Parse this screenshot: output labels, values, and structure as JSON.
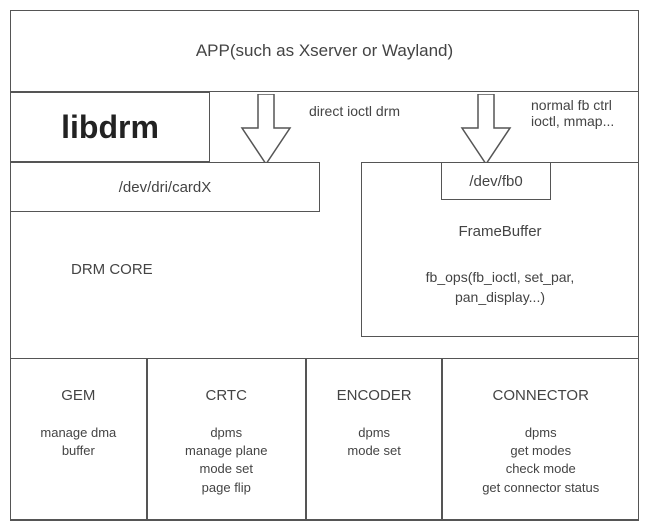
{
  "app": {
    "label": "APP(such as Xserver or Wayland)"
  },
  "libdrm": {
    "label": "libdrm"
  },
  "arrows": {
    "direct": {
      "label": "direct ioctl drm"
    },
    "normal": {
      "label": "normal fb ctrl\nioctl, mmap..."
    }
  },
  "devdri": {
    "label": "/dev/dri/cardX"
  },
  "devfb0": {
    "label": "/dev/fb0"
  },
  "drmcore": {
    "label": "DRM CORE"
  },
  "framebuffer": {
    "title": "FrameBuffer",
    "ops1": "fb_ops(fb_ioctl, set_par,",
    "ops2": "pan_display...)"
  },
  "bottom": {
    "gem": {
      "title": "GEM",
      "d1": "manage dma",
      "d2": "buffer"
    },
    "crtc": {
      "title": "CRTC",
      "d1": "dpms",
      "d2": "manage plane",
      "d3": "mode set",
      "d4": "page flip"
    },
    "encoder": {
      "title": "ENCODER",
      "d1": "dpms",
      "d2": "mode set"
    },
    "connector": {
      "title": "CONNECTOR",
      "d1": "dpms",
      "d2": "get modes",
      "d3": "check mode",
      "d4": "get connector status"
    }
  }
}
